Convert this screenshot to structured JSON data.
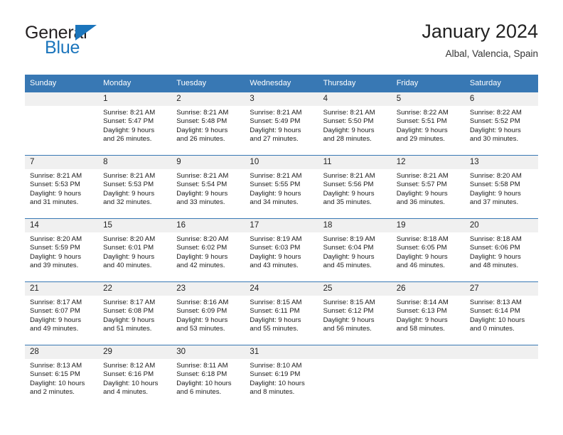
{
  "brand": {
    "name_top": "General",
    "name_bottom": "Blue",
    "flag_icon": "triangle-flag-icon"
  },
  "header": {
    "title": "January 2024",
    "subtitle": "Albal, Valencia, Spain"
  },
  "colors": {
    "header_blue": "#3878b4",
    "brand_blue": "#1b75bc",
    "daynum_bg": "#f0f0f0",
    "text": "#1a1a1a"
  },
  "weekday_headers": [
    "Sunday",
    "Monday",
    "Tuesday",
    "Wednesday",
    "Thursday",
    "Friday",
    "Saturday"
  ],
  "weeks": [
    [
      {
        "day": "",
        "sunrise": "",
        "sunset": "",
        "daylight_line1": "",
        "daylight_line2": "",
        "empty": true
      },
      {
        "day": "1",
        "sunrise": "Sunrise: 8:21 AM",
        "sunset": "Sunset: 5:47 PM",
        "daylight_line1": "Daylight: 9 hours",
        "daylight_line2": "and 26 minutes."
      },
      {
        "day": "2",
        "sunrise": "Sunrise: 8:21 AM",
        "sunset": "Sunset: 5:48 PM",
        "daylight_line1": "Daylight: 9 hours",
        "daylight_line2": "and 26 minutes."
      },
      {
        "day": "3",
        "sunrise": "Sunrise: 8:21 AM",
        "sunset": "Sunset: 5:49 PM",
        "daylight_line1": "Daylight: 9 hours",
        "daylight_line2": "and 27 minutes."
      },
      {
        "day": "4",
        "sunrise": "Sunrise: 8:21 AM",
        "sunset": "Sunset: 5:50 PM",
        "daylight_line1": "Daylight: 9 hours",
        "daylight_line2": "and 28 minutes."
      },
      {
        "day": "5",
        "sunrise": "Sunrise: 8:22 AM",
        "sunset": "Sunset: 5:51 PM",
        "daylight_line1": "Daylight: 9 hours",
        "daylight_line2": "and 29 minutes."
      },
      {
        "day": "6",
        "sunrise": "Sunrise: 8:22 AM",
        "sunset": "Sunset: 5:52 PM",
        "daylight_line1": "Daylight: 9 hours",
        "daylight_line2": "and 30 minutes."
      }
    ],
    [
      {
        "day": "7",
        "sunrise": "Sunrise: 8:21 AM",
        "sunset": "Sunset: 5:53 PM",
        "daylight_line1": "Daylight: 9 hours",
        "daylight_line2": "and 31 minutes."
      },
      {
        "day": "8",
        "sunrise": "Sunrise: 8:21 AM",
        "sunset": "Sunset: 5:53 PM",
        "daylight_line1": "Daylight: 9 hours",
        "daylight_line2": "and 32 minutes."
      },
      {
        "day": "9",
        "sunrise": "Sunrise: 8:21 AM",
        "sunset": "Sunset: 5:54 PM",
        "daylight_line1": "Daylight: 9 hours",
        "daylight_line2": "and 33 minutes."
      },
      {
        "day": "10",
        "sunrise": "Sunrise: 8:21 AM",
        "sunset": "Sunset: 5:55 PM",
        "daylight_line1": "Daylight: 9 hours",
        "daylight_line2": "and 34 minutes."
      },
      {
        "day": "11",
        "sunrise": "Sunrise: 8:21 AM",
        "sunset": "Sunset: 5:56 PM",
        "daylight_line1": "Daylight: 9 hours",
        "daylight_line2": "and 35 minutes."
      },
      {
        "day": "12",
        "sunrise": "Sunrise: 8:21 AM",
        "sunset": "Sunset: 5:57 PM",
        "daylight_line1": "Daylight: 9 hours",
        "daylight_line2": "and 36 minutes."
      },
      {
        "day": "13",
        "sunrise": "Sunrise: 8:20 AM",
        "sunset": "Sunset: 5:58 PM",
        "daylight_line1": "Daylight: 9 hours",
        "daylight_line2": "and 37 minutes."
      }
    ],
    [
      {
        "day": "14",
        "sunrise": "Sunrise: 8:20 AM",
        "sunset": "Sunset: 5:59 PM",
        "daylight_line1": "Daylight: 9 hours",
        "daylight_line2": "and 39 minutes."
      },
      {
        "day": "15",
        "sunrise": "Sunrise: 8:20 AM",
        "sunset": "Sunset: 6:01 PM",
        "daylight_line1": "Daylight: 9 hours",
        "daylight_line2": "and 40 minutes."
      },
      {
        "day": "16",
        "sunrise": "Sunrise: 8:20 AM",
        "sunset": "Sunset: 6:02 PM",
        "daylight_line1": "Daylight: 9 hours",
        "daylight_line2": "and 42 minutes."
      },
      {
        "day": "17",
        "sunrise": "Sunrise: 8:19 AM",
        "sunset": "Sunset: 6:03 PM",
        "daylight_line1": "Daylight: 9 hours",
        "daylight_line2": "and 43 minutes."
      },
      {
        "day": "18",
        "sunrise": "Sunrise: 8:19 AM",
        "sunset": "Sunset: 6:04 PM",
        "daylight_line1": "Daylight: 9 hours",
        "daylight_line2": "and 45 minutes."
      },
      {
        "day": "19",
        "sunrise": "Sunrise: 8:18 AM",
        "sunset": "Sunset: 6:05 PM",
        "daylight_line1": "Daylight: 9 hours",
        "daylight_line2": "and 46 minutes."
      },
      {
        "day": "20",
        "sunrise": "Sunrise: 8:18 AM",
        "sunset": "Sunset: 6:06 PM",
        "daylight_line1": "Daylight: 9 hours",
        "daylight_line2": "and 48 minutes."
      }
    ],
    [
      {
        "day": "21",
        "sunrise": "Sunrise: 8:17 AM",
        "sunset": "Sunset: 6:07 PM",
        "daylight_line1": "Daylight: 9 hours",
        "daylight_line2": "and 49 minutes."
      },
      {
        "day": "22",
        "sunrise": "Sunrise: 8:17 AM",
        "sunset": "Sunset: 6:08 PM",
        "daylight_line1": "Daylight: 9 hours",
        "daylight_line2": "and 51 minutes."
      },
      {
        "day": "23",
        "sunrise": "Sunrise: 8:16 AM",
        "sunset": "Sunset: 6:09 PM",
        "daylight_line1": "Daylight: 9 hours",
        "daylight_line2": "and 53 minutes."
      },
      {
        "day": "24",
        "sunrise": "Sunrise: 8:15 AM",
        "sunset": "Sunset: 6:11 PM",
        "daylight_line1": "Daylight: 9 hours",
        "daylight_line2": "and 55 minutes."
      },
      {
        "day": "25",
        "sunrise": "Sunrise: 8:15 AM",
        "sunset": "Sunset: 6:12 PM",
        "daylight_line1": "Daylight: 9 hours",
        "daylight_line2": "and 56 minutes."
      },
      {
        "day": "26",
        "sunrise": "Sunrise: 8:14 AM",
        "sunset": "Sunset: 6:13 PM",
        "daylight_line1": "Daylight: 9 hours",
        "daylight_line2": "and 58 minutes."
      },
      {
        "day": "27",
        "sunrise": "Sunrise: 8:13 AM",
        "sunset": "Sunset: 6:14 PM",
        "daylight_line1": "Daylight: 10 hours",
        "daylight_line2": "and 0 minutes."
      }
    ],
    [
      {
        "day": "28",
        "sunrise": "Sunrise: 8:13 AM",
        "sunset": "Sunset: 6:15 PM",
        "daylight_line1": "Daylight: 10 hours",
        "daylight_line2": "and 2 minutes."
      },
      {
        "day": "29",
        "sunrise": "Sunrise: 8:12 AM",
        "sunset": "Sunset: 6:16 PM",
        "daylight_line1": "Daylight: 10 hours",
        "daylight_line2": "and 4 minutes."
      },
      {
        "day": "30",
        "sunrise": "Sunrise: 8:11 AM",
        "sunset": "Sunset: 6:18 PM",
        "daylight_line1": "Daylight: 10 hours",
        "daylight_line2": "and 6 minutes."
      },
      {
        "day": "31",
        "sunrise": "Sunrise: 8:10 AM",
        "sunset": "Sunset: 6:19 PM",
        "daylight_line1": "Daylight: 10 hours",
        "daylight_line2": "and 8 minutes."
      },
      {
        "day": "",
        "sunrise": "",
        "sunset": "",
        "daylight_line1": "",
        "daylight_line2": "",
        "empty": true
      },
      {
        "day": "",
        "sunrise": "",
        "sunset": "",
        "daylight_line1": "",
        "daylight_line2": "",
        "empty": true
      },
      {
        "day": "",
        "sunrise": "",
        "sunset": "",
        "daylight_line1": "",
        "daylight_line2": "",
        "empty": true
      }
    ]
  ]
}
